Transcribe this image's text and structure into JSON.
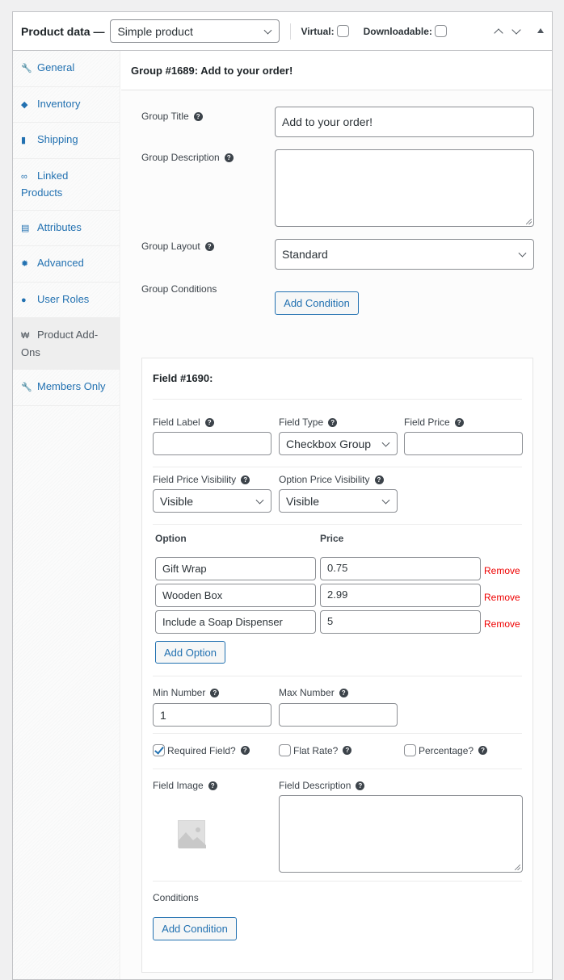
{
  "header": {
    "title": "Product data —",
    "product_type": "Simple product",
    "virtual_label": "Virtual:",
    "virtual_checked": false,
    "downloadable_label": "Downloadable:",
    "downloadable_checked": false,
    "move_up_icon": "chevron-up-icon",
    "move_down_icon": "chevron-down-icon",
    "toggle_icon": "triangle-up-icon"
  },
  "sidebar": {
    "items": [
      {
        "label": "General",
        "icon": "wrench-icon",
        "glyph": "🔧",
        "active": false
      },
      {
        "label": "Inventory",
        "icon": "tag-icon",
        "glyph": "◆",
        "active": false
      },
      {
        "label": "Shipping",
        "icon": "truck-icon",
        "glyph": "▮",
        "active": false
      },
      {
        "label": "Linked Products",
        "icon": "link-icon",
        "glyph": "∞",
        "active": false
      },
      {
        "label": "Attributes",
        "icon": "list-icon",
        "glyph": "▤",
        "active": false
      },
      {
        "label": "Advanced",
        "icon": "gear-icon",
        "glyph": "✹",
        "active": false
      },
      {
        "label": "User Roles",
        "icon": "user-icon",
        "glyph": "●",
        "active": false
      },
      {
        "label": "Product Add-Ons",
        "icon": "cart-icon",
        "glyph": "₩",
        "active": true
      },
      {
        "label": "Members Only",
        "icon": "wrench-icon",
        "glyph": "🔧",
        "active": false
      }
    ]
  },
  "group": {
    "heading": "Group #1689: Add to your order!",
    "title_label": "Group Title",
    "title_value": "Add to your order!",
    "description_label": "Group Description",
    "description_value": "",
    "layout_label": "Group Layout",
    "layout_value": "Standard",
    "conditions_label": "Group Conditions",
    "add_condition_label": "Add Condition"
  },
  "field": {
    "heading": "Field #1690:",
    "label_label": "Field Label",
    "label_value": "",
    "type_label": "Field Type",
    "type_value": "Checkbox Group",
    "price_label": "Field Price",
    "price_value": "",
    "price_visibility_label": "Field Price Visibility",
    "price_visibility_value": "Visible",
    "option_price_visibility_label": "Option Price Visibility",
    "option_price_visibility_value": "Visible",
    "options_header": {
      "option": "Option",
      "price": "Price"
    },
    "options": [
      {
        "name": "Gift Wrap",
        "price": "0.75",
        "remove": "Remove"
      },
      {
        "name": "Wooden Box",
        "price": "2.99",
        "remove": "Remove"
      },
      {
        "name": "Include a Soap Dispenser",
        "price": "5",
        "remove": "Remove"
      }
    ],
    "add_option_label": "Add Option",
    "min_label": "Min Number",
    "min_value": "1",
    "max_label": "Max Number",
    "max_value": "",
    "required_label": "Required Field?",
    "required_checked": true,
    "flat_rate_label": "Flat Rate?",
    "flat_rate_checked": false,
    "percentage_label": "Percentage?",
    "percentage_checked": false,
    "image_label": "Field Image",
    "description_label": "Field Description",
    "description_value": "",
    "conditions_label": "Conditions",
    "add_condition_label": "Add Condition"
  },
  "colors": {
    "link": "#2271b1",
    "remove": "#ee0000",
    "active_tab_bg": "#eeeeee"
  }
}
